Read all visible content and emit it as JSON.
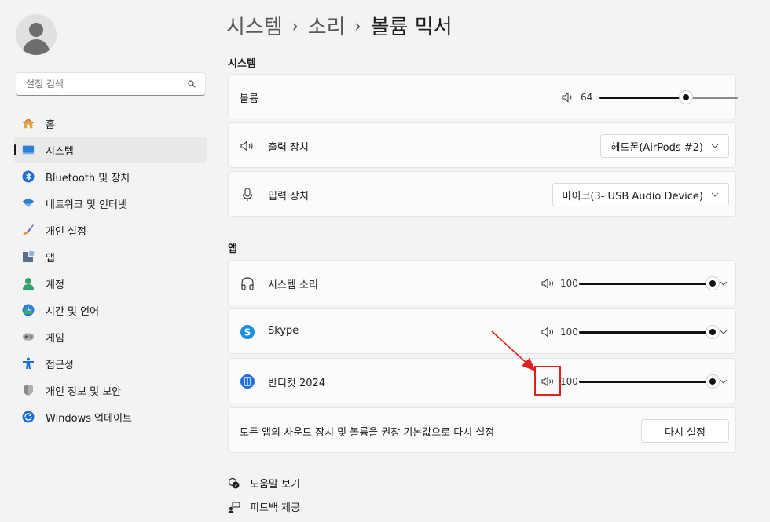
{
  "breadcrumb": {
    "part1": "시스템",
    "part2": "소리",
    "part3": "볼륨 믹서",
    "sep": "›"
  },
  "search": {
    "placeholder": "설정 검색"
  },
  "sidebar": {
    "items": [
      {
        "label": "홈",
        "icon": "home-icon"
      },
      {
        "label": "시스템",
        "icon": "system-icon"
      },
      {
        "label": "Bluetooth 및 장치",
        "icon": "bluetooth-icon"
      },
      {
        "label": "네트워크 및 인터넷",
        "icon": "network-icon"
      },
      {
        "label": "개인 설정",
        "icon": "brush-icon"
      },
      {
        "label": "앱",
        "icon": "apps-icon"
      },
      {
        "label": "계정",
        "icon": "account-icon"
      },
      {
        "label": "시간 및 언어",
        "icon": "time-language-icon"
      },
      {
        "label": "게임",
        "icon": "gaming-icon"
      },
      {
        "label": "접근성",
        "icon": "accessibility-icon"
      },
      {
        "label": "개인 정보 및 보안",
        "icon": "shield-icon"
      },
      {
        "label": "Windows 업데이트",
        "icon": "update-icon"
      }
    ],
    "active_index": 1
  },
  "system_section": {
    "title": "시스템",
    "volume": {
      "label": "볼륨",
      "value": "64",
      "level": 0.64
    },
    "output": {
      "label": "출력 장치",
      "selected": "헤드폰(AirPods #2)"
    },
    "input": {
      "label": "입력 장치",
      "selected": "마이크(3- USB Audio Device)"
    }
  },
  "apps_section": {
    "title": "앱",
    "apps": [
      {
        "name": "시스템 소리",
        "value": "100",
        "level": 1.0,
        "icon": "headphones-icon"
      },
      {
        "name": "Skype",
        "value": "100",
        "level": 1.0,
        "icon": "skype-icon"
      },
      {
        "name": "반디컷 2024",
        "value": "100",
        "level": 1.0,
        "icon": "bandicut-icon"
      }
    ],
    "reset": {
      "label": "모든 앱의 사운드 장치 및 볼륨을 권장 기본값으로 다시 설정",
      "button": "다시 설정"
    }
  },
  "footer": {
    "help": "도움말 보기",
    "feedback": "피드백 제공"
  },
  "colors": {
    "accent": "#0067c0",
    "annotation": "#e0201a",
    "slider_fill": "#111111",
    "slider_rest": "#8a8a8a"
  }
}
